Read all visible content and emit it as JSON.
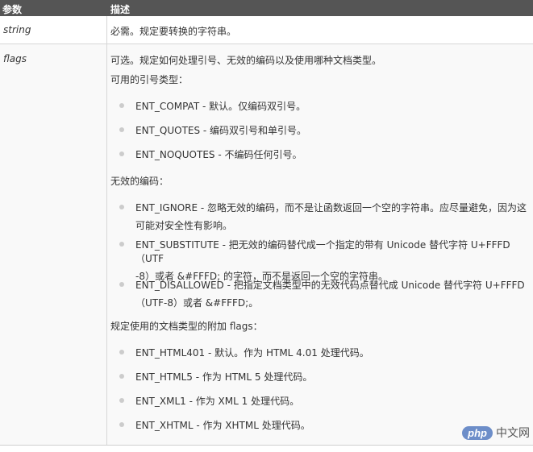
{
  "header": {
    "param": "参数",
    "desc": "描述"
  },
  "rows": [
    {
      "param": "string",
      "desc": "必需。规定要转换的字符串。"
    },
    {
      "param": "flags",
      "intro": "可选。规定如何处理引号、无效的编码以及使用哪种文档类型。",
      "quote_title": "可用的引号类型：",
      "quote_items": [
        "ENT_COMPAT - 默认。仅编码双引号。",
        "ENT_QUOTES - 编码双引号和单引号。",
        "ENT_NOQUOTES - 不编码任何引号。"
      ],
      "invalid_title": "无效的编码：",
      "invalid_items": [
        [
          "ENT_IGNORE - 忽略无效的编码，而不是让函数返回一个空的字符串。应尽量避免，因为这",
          "可能对安全性有影响。"
        ],
        [
          "ENT_SUBSTITUTE - 把无效的编码替代成一个指定的带有 Unicode 替代字符 U+FFFD（UTF",
          "-8）或者 &#FFFD; 的字符，而不是返回一个空的字符串。"
        ],
        [
          "ENT_DISALLOWED - 把指定文档类型中的无效代码点替代成 Unicode 替代字符 U+FFFD",
          "（UTF-8）或者 &#FFFD;。"
        ]
      ],
      "doctype_title": "规定使用的文档类型的附加 flags：",
      "doctype_items": [
        "ENT_HTML401 - 默认。作为 HTML 4.01 处理代码。",
        "ENT_HTML5 - 作为 HTML 5 处理代码。",
        "ENT_XML1 - 作为 XML 1 处理代码。",
        "ENT_XHTML - 作为 XHTML 处理代码。"
      ]
    }
  ],
  "watermark": {
    "logo": "php",
    "text": "中文网"
  }
}
